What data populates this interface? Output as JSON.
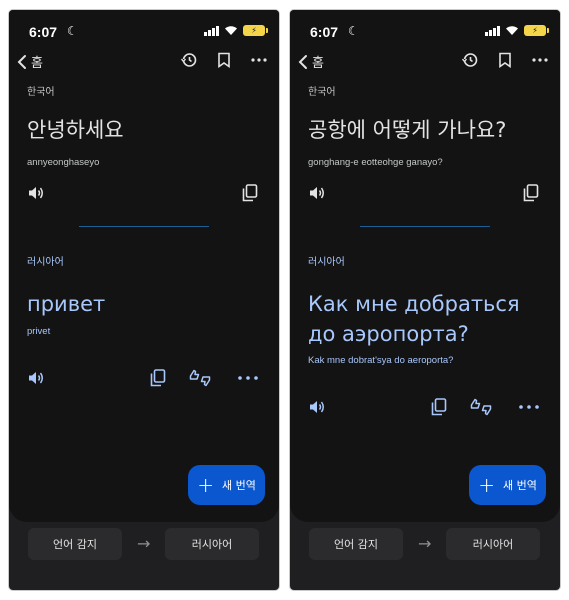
{
  "status": {
    "time": "6:07",
    "battery": "⚡"
  },
  "nav": {
    "back_label": "홈"
  },
  "screens": [
    {
      "source_lang": "한국어",
      "source_text": "안녕하세요",
      "source_roman": "annyeonghaseyo",
      "target_lang": "러시아어",
      "target_text": "привет",
      "target_roman": "privet",
      "fab_label": "새 번역",
      "lang_from": "언어 감지",
      "lang_to": "러시아어"
    },
    {
      "source_lang": "한국어",
      "source_text": "공항에 어떻게 가나요?",
      "source_roman": "gonghang-e eotteohge ganayo?",
      "target_lang": "러시아어",
      "target_text": "Как мне добраться до аэропорта?",
      "target_roman": "Kak mne dobrat'sya do aeroporta?",
      "fab_label": "새 번역",
      "lang_from": "언어 감지",
      "lang_to": "러시아어"
    }
  ],
  "colors": {
    "accent": "#a8c7fa",
    "fab": "#0b57d0",
    "background": "#131314"
  }
}
